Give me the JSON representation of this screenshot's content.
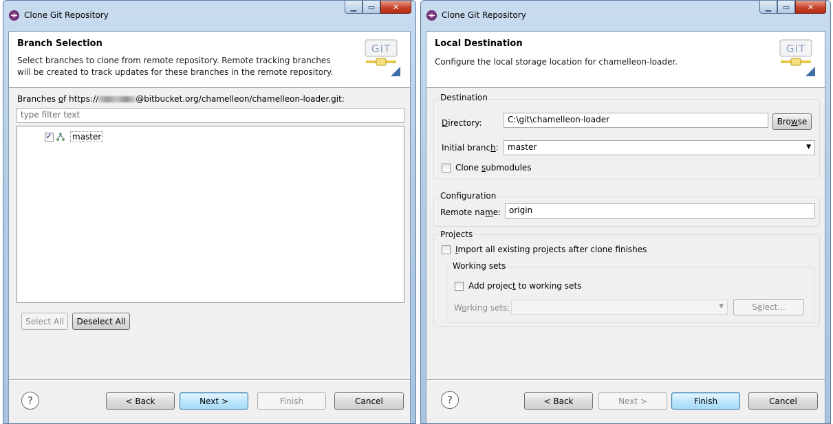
{
  "left_window": {
    "title": "Clone Git Repository",
    "header": {
      "title": "Branch Selection",
      "description_line1": "Select branches to clone from remote repository. Remote tracking branches",
      "description_line2": "will be created to track updates for these branches in the remote repository."
    },
    "logo_text": "GIT",
    "branches_label_prefix": "Branches ",
    "branches_label_of": "o",
    "branches_label_mid": "f https://",
    "branches_label_suffix": "@bitbucket.org/chamelleon/chamelleon-loader.git:",
    "filter_placeholder": "type filter text",
    "branches": [
      {
        "name": "master",
        "checked": true
      }
    ],
    "buttons": {
      "select_all": "Select All",
      "deselect_all": "Deselect All",
      "help": "?",
      "back": "< Back",
      "next": "Next >",
      "finish": "Finish",
      "cancel": "Cancel"
    }
  },
  "right_window": {
    "title": "Clone Git Repository",
    "header": {
      "title": "Local Destination",
      "description": "Configure the local storage location for chamelleon-loader."
    },
    "logo_text": "GIT",
    "destination": {
      "group_label": "Destination",
      "directory_label": "Directory:",
      "directory_value": "C:\\git\\chamelleon-loader",
      "browse_label": "Browse",
      "initial_branch_label": "Initial branch:",
      "initial_branch_value": "master",
      "clone_submodules_label": "Clone submodules",
      "clone_submodules_checked": false
    },
    "configuration": {
      "group_label": "Configuration",
      "remote_name_label": "Remote name:",
      "remote_name_value": "origin"
    },
    "projects": {
      "group_label": "Projects",
      "import_label": "Import all existing projects after clone finishes",
      "import_checked": false,
      "working_sets": {
        "group_label": "Working sets",
        "add_label": "Add project to working sets",
        "add_checked": false,
        "field_label": "Working sets:",
        "field_value": "",
        "select_label": "Select..."
      }
    },
    "buttons": {
      "help": "?",
      "back": "< Back",
      "next": "Next >",
      "finish": "Finish",
      "cancel": "Cancel"
    }
  }
}
